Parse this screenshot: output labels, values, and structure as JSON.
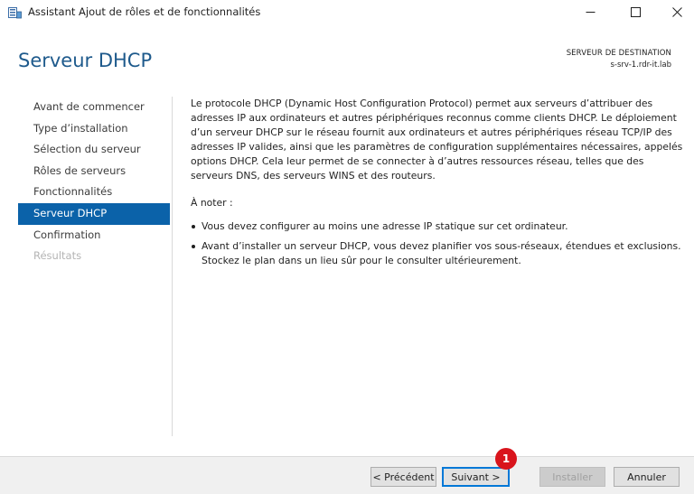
{
  "window": {
    "title": "Assistant Ajout de rôles et de fonctionnalités",
    "icon": "server-manager-icon",
    "controls": [
      "minimize-icon",
      "maximize-icon",
      "close-icon"
    ]
  },
  "header": {
    "page_title": "Serveur DHCP",
    "destination_label": "SERVEUR DE DESTINATION",
    "destination_server": "s-srv-1.rdr-it.lab"
  },
  "nav": {
    "items": [
      {
        "label": "Avant de commencer",
        "state": "normal"
      },
      {
        "label": "Type d’installation",
        "state": "normal"
      },
      {
        "label": "Sélection du serveur",
        "state": "normal"
      },
      {
        "label": "Rôles de serveurs",
        "state": "normal"
      },
      {
        "label": "Fonctionnalités",
        "state": "normal"
      },
      {
        "label": "Serveur DHCP",
        "state": "active"
      },
      {
        "label": "Confirmation",
        "state": "normal"
      },
      {
        "label": "Résultats",
        "state": "disabled"
      }
    ]
  },
  "content": {
    "intro": "Le protocole DHCP (Dynamic Host Configuration Protocol) permet aux serveurs d’attribuer des adresses IP aux ordinateurs et autres périphériques reconnus comme clients DHCP. Le déploiement d’un serveur DHCP sur le réseau fournit aux ordinateurs et autres périphériques réseau TCP/IP des adresses IP valides, ainsi que les paramètres de configuration supplémentaires nécessaires, appelés options DHCP. Cela leur permet de se connecter à d’autres ressources réseau, telles que des serveurs DNS, des serveurs WINS et des routeurs.",
    "note_title": "À noter :",
    "bullets": [
      "Vous devez configurer au moins une adresse IP statique sur cet ordinateur.",
      "Avant d’installer un serveur DHCP, vous devez planifier vos sous-réseaux, étendues et exclusions. Stockez le plan dans un lieu sûr pour le consulter ultérieurement."
    ]
  },
  "footer": {
    "prev_label": "< Précédent",
    "next_label": "Suivant >",
    "install_label": "Installer",
    "cancel_label": "Annuler"
  },
  "annotation": {
    "step_number": "1",
    "color": "#d9141c"
  },
  "colors": {
    "accent": "#0b62a9",
    "title": "#1e5a8c"
  }
}
